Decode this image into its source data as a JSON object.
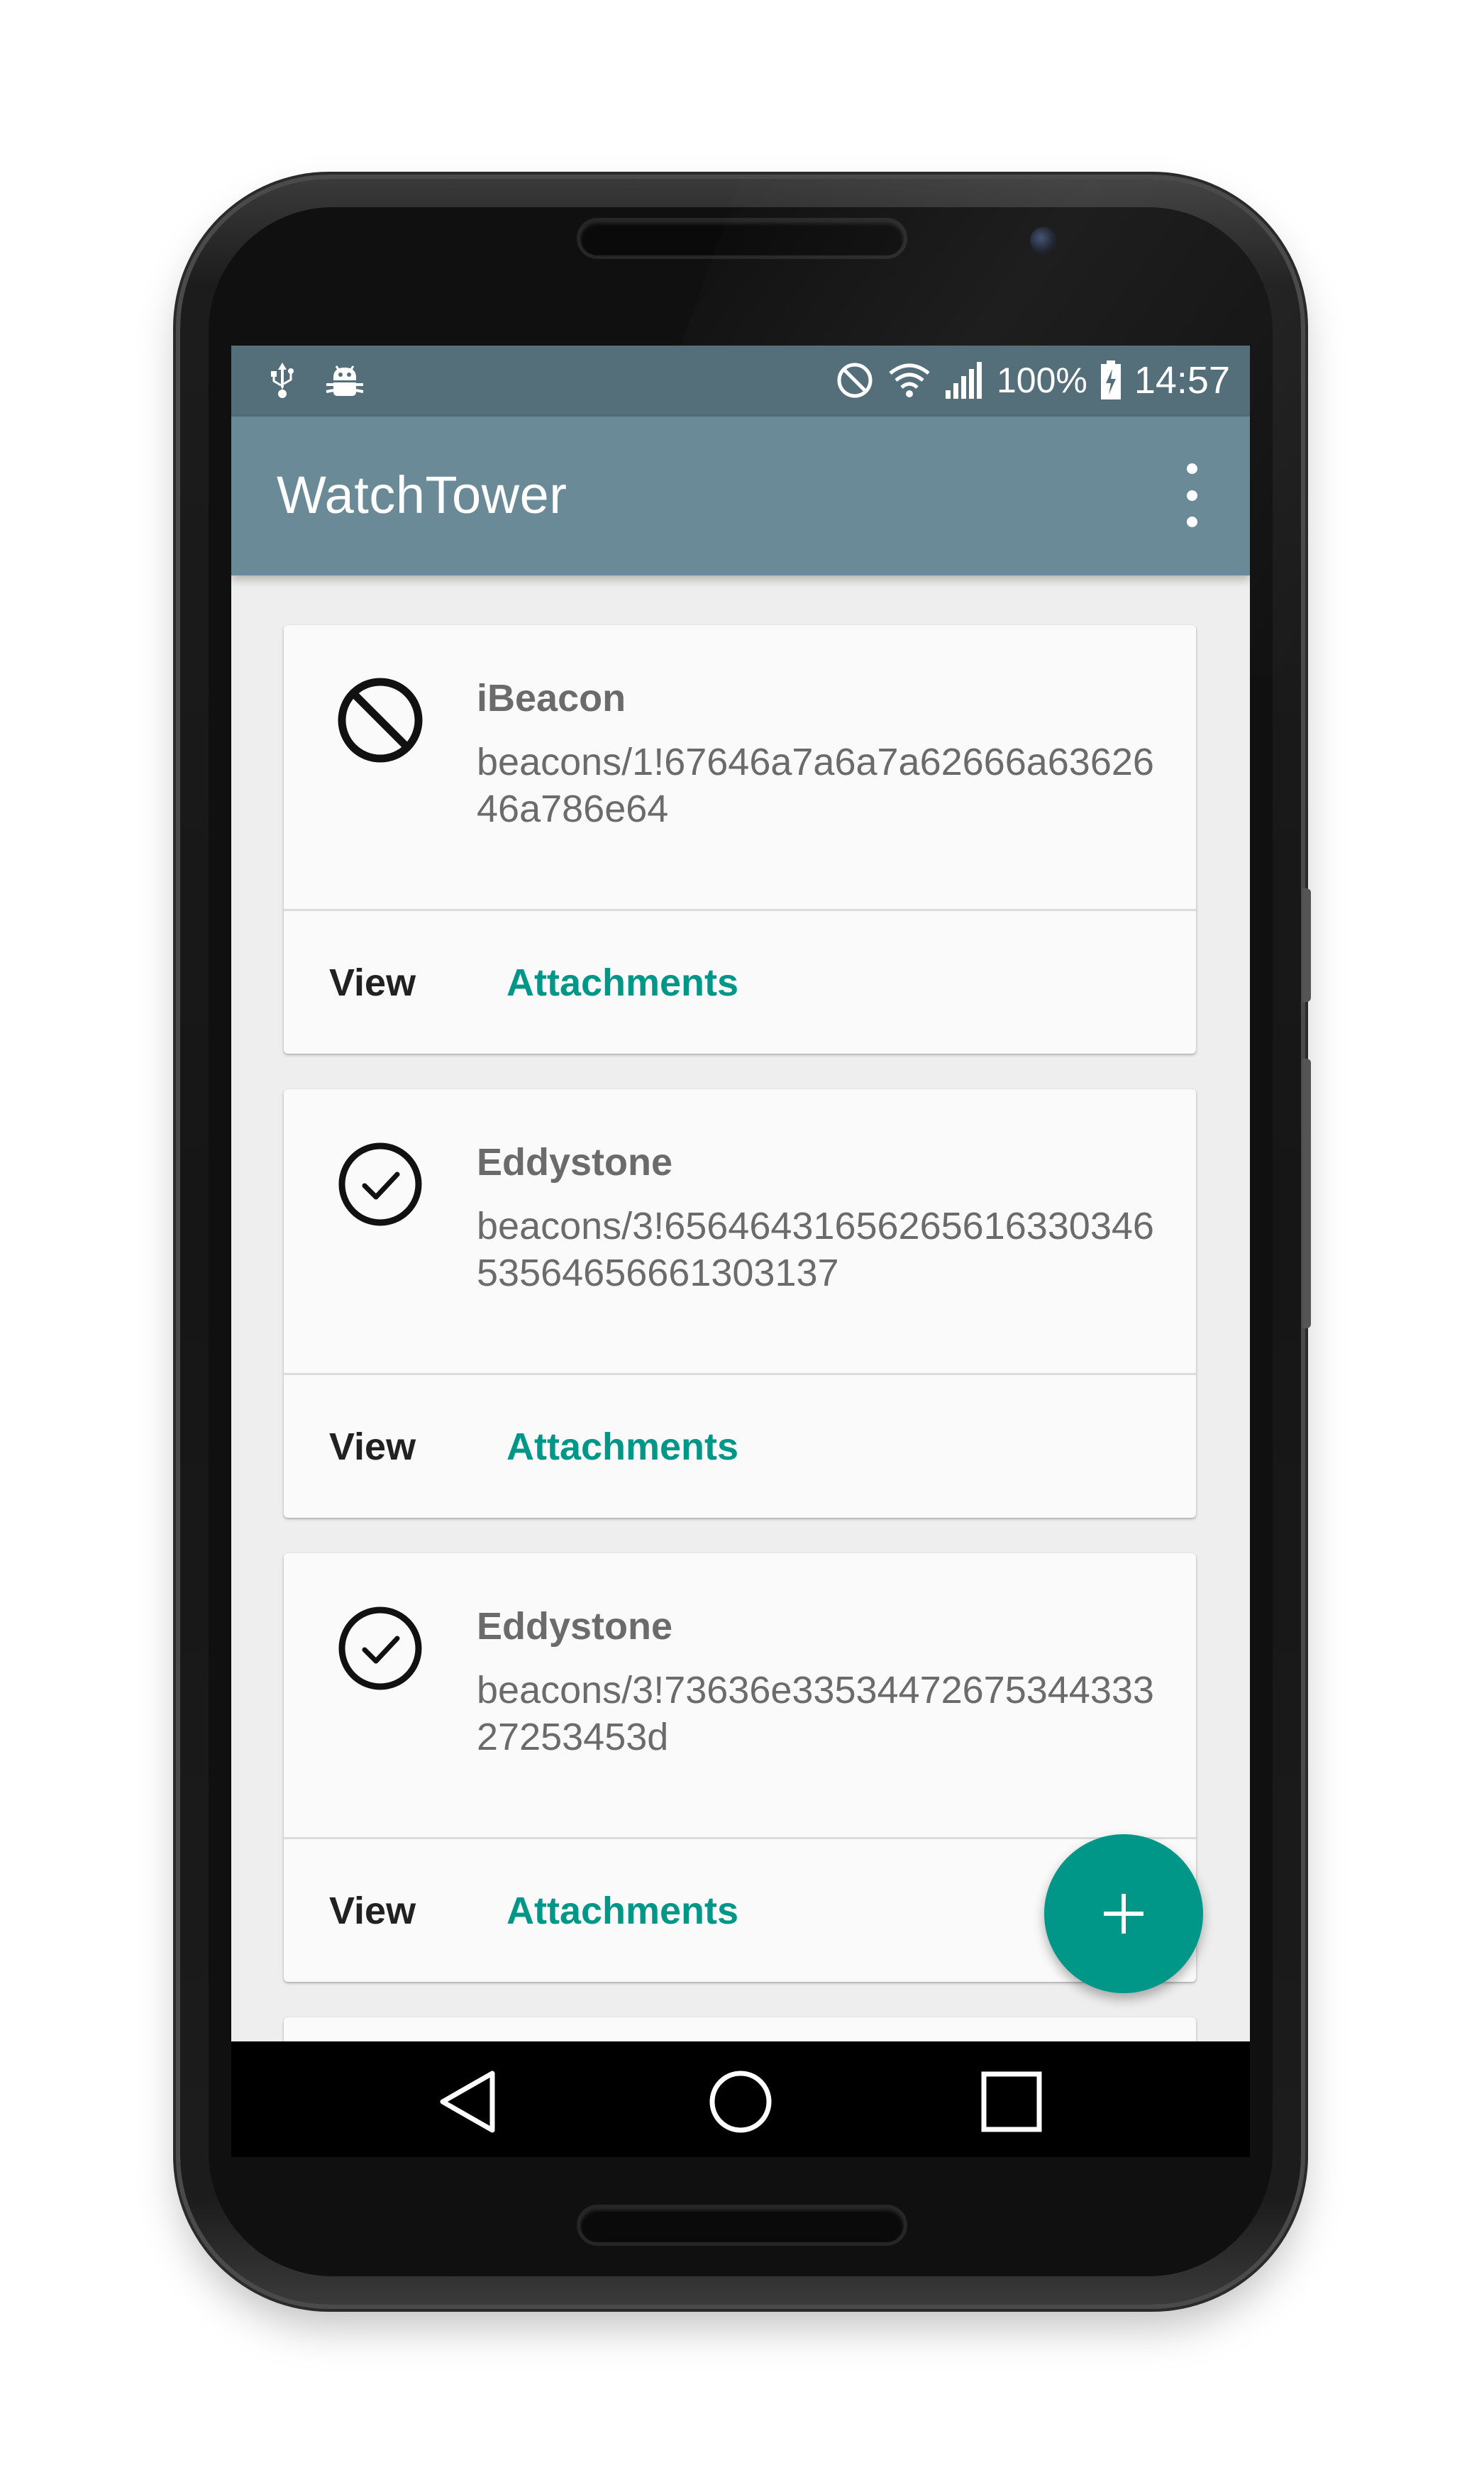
{
  "status_bar": {
    "battery_percent": "100%",
    "time": "14:57",
    "icons": [
      "usb-icon",
      "debug-icon",
      "dnd-icon",
      "wifi-icon",
      "signal-icon",
      "battery-charging-icon"
    ]
  },
  "app_bar": {
    "title": "WatchTower",
    "overflow_icon": "more-vert-icon"
  },
  "cards": [
    {
      "type": "iBeacon",
      "id": "beacons/1!67646a7a6a7a62666a6362646a786e64",
      "status_icon": "blocked-icon",
      "view_label": "View",
      "attachments_label": "Attachments"
    },
    {
      "type": "Eddystone",
      "id": "beacons/3!6564643165626561633034653564656661303137",
      "status_icon": "check-circle-icon",
      "view_label": "View",
      "attachments_label": "Attachments"
    },
    {
      "type": "Eddystone",
      "id": "beacons/3!73636e3353447267534433327253453d",
      "status_icon": "check-circle-icon",
      "view_label": "View",
      "attachments_label": "Attachments"
    }
  ],
  "fab": {
    "icon": "add-icon"
  },
  "nav_bar": {
    "icons": [
      "back-icon",
      "home-icon",
      "recents-icon"
    ]
  },
  "colors": {
    "status_bar": "#546e7a",
    "app_bar": "#6a8a98",
    "accent": "#009688",
    "background": "#eeeeee",
    "card": "#fafafa"
  }
}
